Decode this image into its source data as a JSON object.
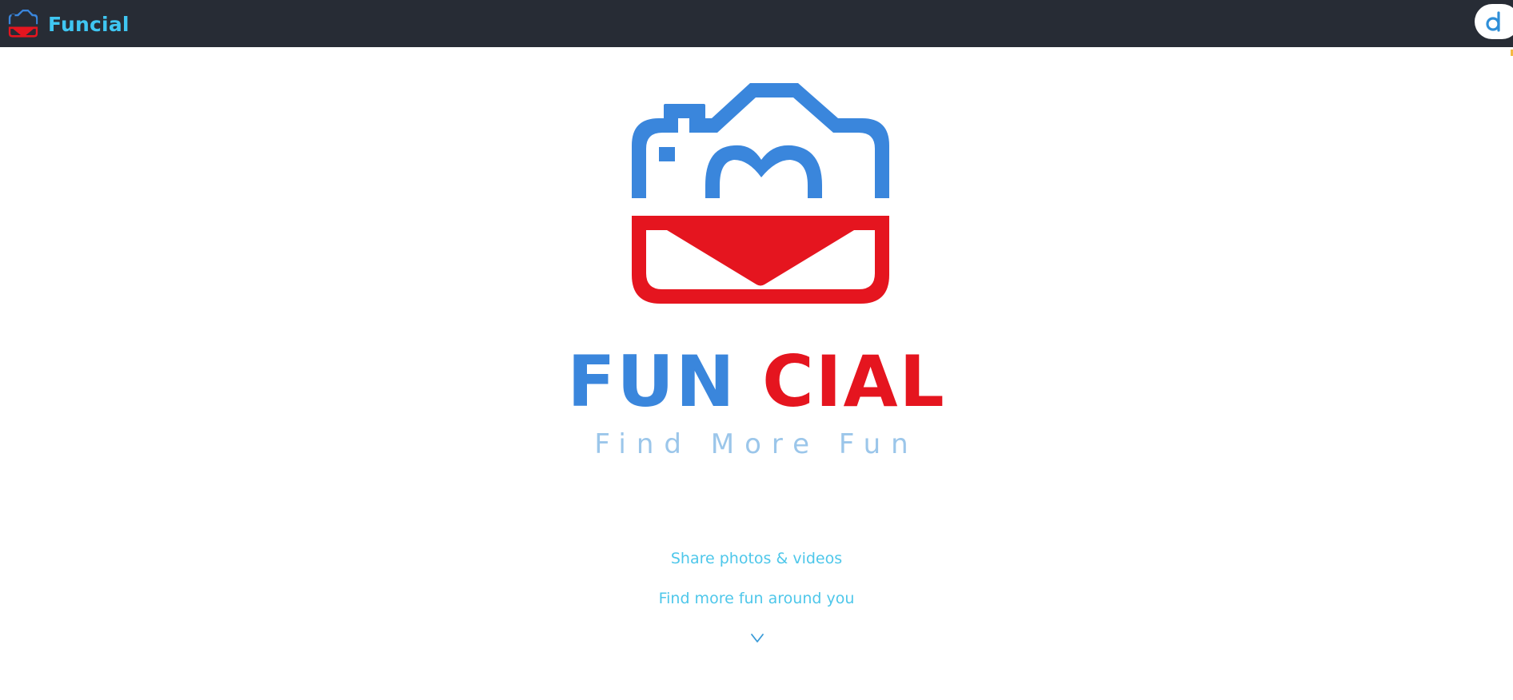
{
  "header": {
    "app_name": "Funcial",
    "logo_icon": "camera-heart-logo",
    "extension_icon": "d-letter-icon"
  },
  "hero": {
    "logo_icon": "camera-heart-logo",
    "wordmark_part1": "FUN",
    "wordmark_part2": "CIAL",
    "tagline": "Find More Fun",
    "features": [
      "Share photos & videos",
      "Find more fun around you"
    ],
    "scroll_icon": "chevron-down-icon"
  },
  "colors": {
    "topbar": "#272c35",
    "brand_text": "#3fc6f2",
    "logo_blue": "#3a86dc",
    "logo_red": "#e5151f",
    "tagline": "#9bc6ea",
    "feature_text": "#4ec7ea"
  }
}
